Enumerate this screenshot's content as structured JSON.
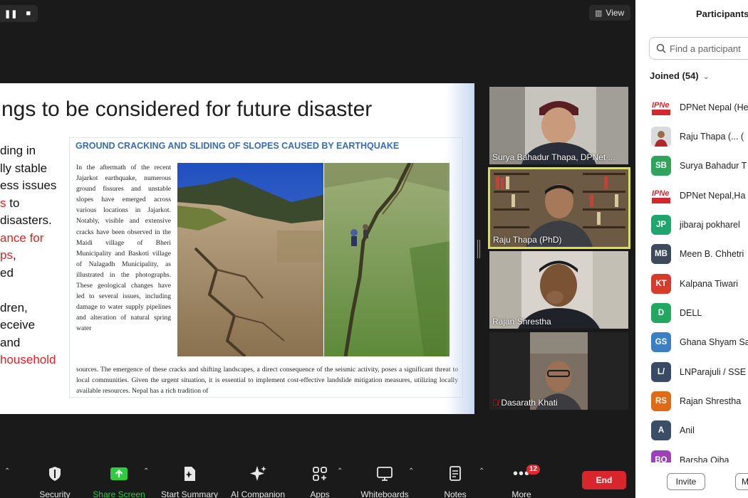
{
  "top_controls": {
    "pause_icon": "pause-icon",
    "stop_icon": "stop-icon"
  },
  "view_button": {
    "label": "View"
  },
  "slide": {
    "title": "ngs to be considered for future disaster",
    "bullets": [
      {
        "text": "ding in",
        "color": "black"
      },
      {
        "text": "lly stable",
        "color": "black"
      },
      {
        "text": "ess issues",
        "color": "black"
      },
      {
        "text_red": "s",
        "text_black": " to",
        "color": "mixed"
      },
      {
        "text": "disasters.",
        "color": "black"
      },
      {
        "text": "ance for",
        "color": "red"
      },
      {
        "text_red": "ps",
        "text_black": ",",
        "color": "mixed"
      },
      {
        "text": "ed",
        "color": "black"
      },
      {
        "text": "",
        "color": "black"
      },
      {
        "text": "dren,",
        "color": "black"
      },
      {
        "text": "eceive",
        "color": "black"
      },
      {
        "text": "and",
        "color": "black"
      },
      {
        "text": "household",
        "color": "red"
      }
    ],
    "doc_heading": "GROUND CRACKING AND SLIDING OF SLOPES CAUSED BY EARTHQUAKE",
    "doc_column": "In the aftermath of the recent Jajarkot earthquake, numerous ground fissures and unstable slopes have emerged across various locations in Jajarkot. Notably, visible and extensive cracks have been observed in the Maidi village of Bheri Municipality and Baskoti village of Nalagadh Municipality, as illustrated in the photographs. These geological changes have led to several issues, including damage to water supply pipelines and alteration of natural spring water",
    "doc_bottom": "sources. The emergence of these cracks and shifting landscapes, a direct consequence of the seismic activity, poses a significant threat to local communities. Given the urgent situation, it is essential to implement cost-effective landslide mitigation measures, utilizing locally available resources. Nepal has a rich tradition of"
  },
  "video_tiles": [
    {
      "name": "Surya Bahadur Thapa, DPNet ...",
      "muted": false,
      "active_speaker": false
    },
    {
      "name": "Raju Thapa (PhD)",
      "muted": false,
      "active_speaker": true
    },
    {
      "name": "Rajan Shrestha",
      "muted": false,
      "active_speaker": false
    },
    {
      "name": "Dasarath Khati",
      "muted": true,
      "active_speaker": false
    }
  ],
  "toolbar": {
    "items": [
      {
        "label": "Security",
        "icon": "shield-icon"
      },
      {
        "label": "Share Screen",
        "icon": "share-screen-icon",
        "color": "#2ecc40"
      },
      {
        "label": "Start Summary",
        "icon": "summary-icon"
      },
      {
        "label": "AI Companion",
        "icon": "sparkle-icon"
      },
      {
        "label": "Apps",
        "icon": "apps-icon"
      },
      {
        "label": "Whiteboards",
        "icon": "whiteboard-icon"
      },
      {
        "label": "Notes",
        "icon": "notes-icon"
      },
      {
        "label": "More",
        "icon": "more-icon"
      }
    ],
    "more_badge": "12",
    "end_label": "End",
    "end_color": "#d9262c"
  },
  "participants": {
    "title": "Participants",
    "search_placeholder": "Find a participant",
    "joined_label": "Joined (54)",
    "list": [
      {
        "initials": "IPNe",
        "name": "DPNet Nepal (He",
        "color": "#ffffff",
        "logo": true
      },
      {
        "initials": "",
        "name": "Raju Thapa (... (",
        "color": "#cccccc",
        "photo": true
      },
      {
        "initials": "SB",
        "name": "Surya Bahadur T",
        "color": "#2ea55a"
      },
      {
        "initials": "IPNe",
        "name": "DPNet Nepal,Ha",
        "color": "#ffffff",
        "logo": true
      },
      {
        "initials": "JP",
        "name": "jibaraj pokharel",
        "color": "#1fa56e"
      },
      {
        "initials": "MB",
        "name": "Meen B. Chhetri",
        "color": "#3e4a5c"
      },
      {
        "initials": "KT",
        "name": "Kalpana Tiwari",
        "color": "#d83b2c"
      },
      {
        "initials": "D",
        "name": "DELL",
        "color": "#23a862"
      },
      {
        "initials": "GS",
        "name": "Ghana Shyam Sa",
        "color": "#3b7fc4"
      },
      {
        "initials": "L/",
        "name": "LNParajuli / SSE",
        "color": "#394a66"
      },
      {
        "initials": "RS",
        "name": "Rajan Shrestha",
        "color": "#e06a16"
      },
      {
        "initials": "A",
        "name": "Anil",
        "color": "#3c4d66"
      },
      {
        "initials": "BO",
        "name": "Barsha Ojha",
        "color": "#9b42b8"
      }
    ],
    "invite_label": "Invite",
    "mute_label": "M"
  }
}
